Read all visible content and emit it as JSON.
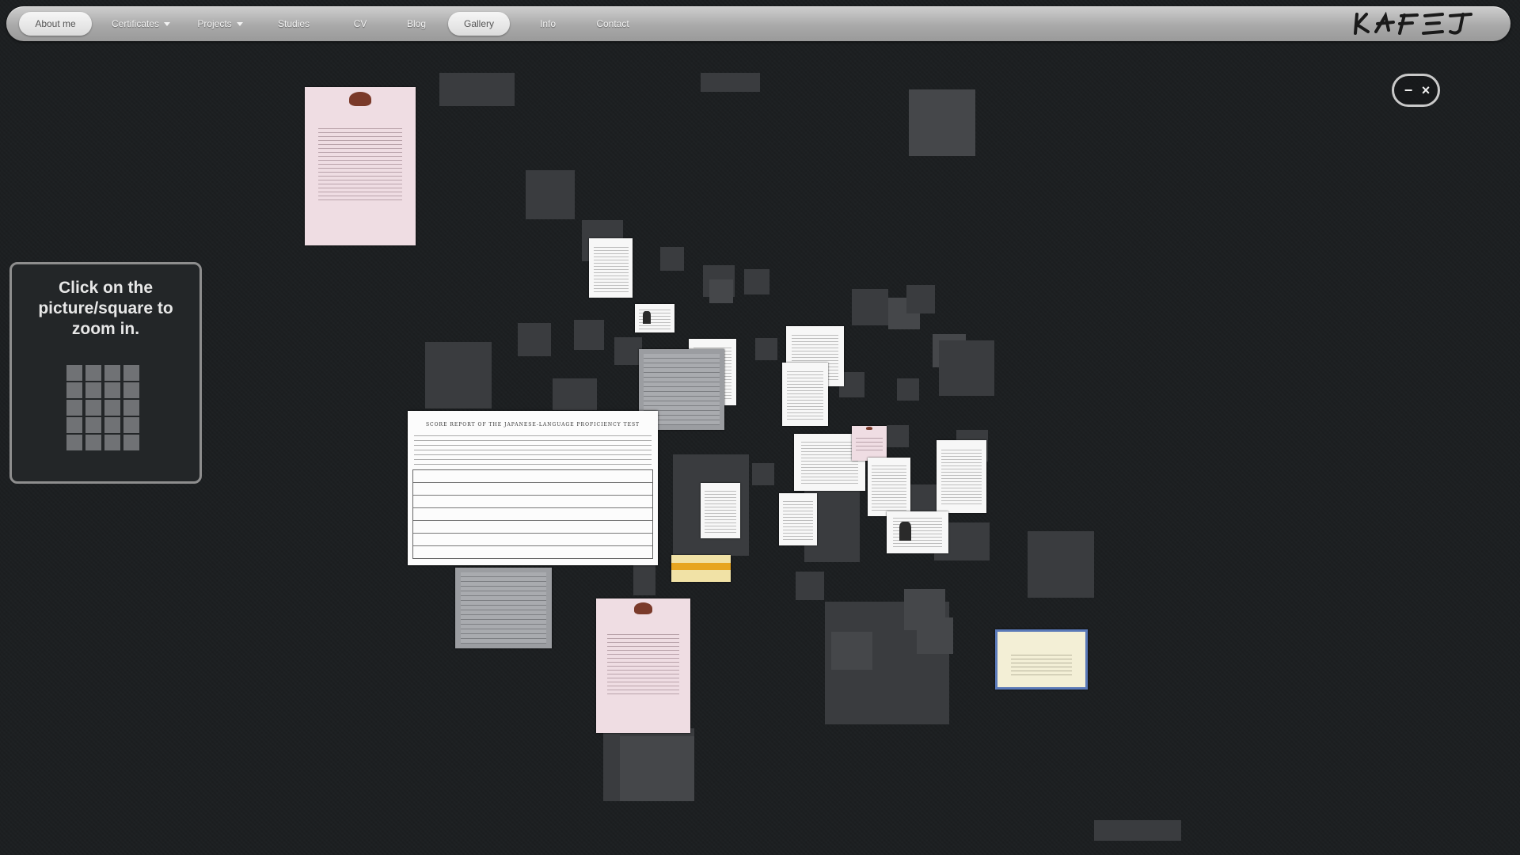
{
  "nav": {
    "items": [
      {
        "label": "About me",
        "active": true,
        "dropdown": false
      },
      {
        "label": "Certificates",
        "active": false,
        "dropdown": true
      },
      {
        "label": "Projects",
        "active": false,
        "dropdown": true
      },
      {
        "label": "Studies",
        "active": false,
        "dropdown": false
      },
      {
        "label": "CV",
        "active": false,
        "dropdown": false
      },
      {
        "label": "Blog",
        "active": false,
        "dropdown": false
      },
      {
        "label": "Gallery",
        "active": true,
        "dropdown": false
      },
      {
        "label": "Info",
        "active": false,
        "dropdown": false
      },
      {
        "label": "Contact",
        "active": false,
        "dropdown": false
      }
    ],
    "logo": "KAFEJ"
  },
  "window_controls": {
    "minimize": "−",
    "close": "×"
  },
  "help": {
    "text": "Click on the picture/square to zoom in."
  },
  "gallery": {
    "score_report_title": "SCORE REPORT OF THE JAPANESE-LANGUAGE PROFICIENCY TEST"
  },
  "colors": {
    "background": "#1c1f21",
    "square": "#3a3c3f",
    "nav_bar": "#b0b0b0"
  }
}
